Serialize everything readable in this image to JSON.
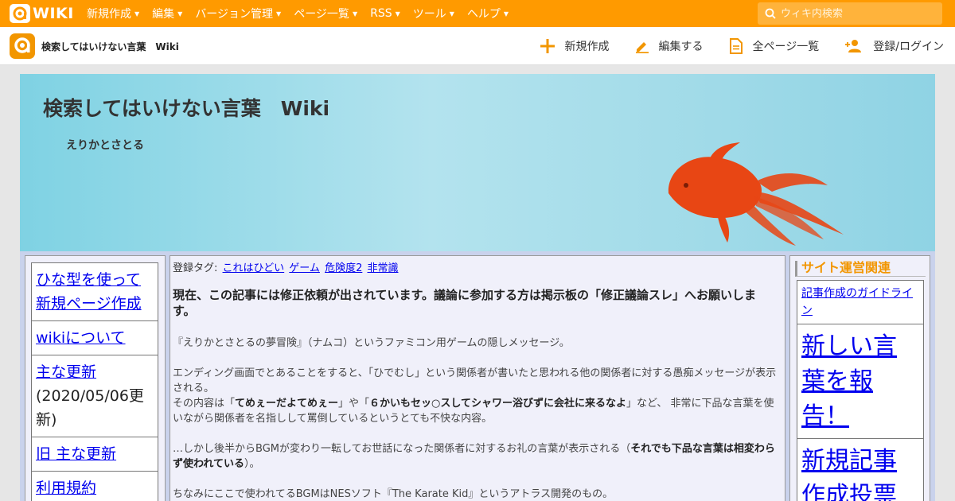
{
  "topbar": {
    "logo_text": "WIKI",
    "menu": [
      {
        "label": "新規作成"
      },
      {
        "label": "編集"
      },
      {
        "label": "バージョン管理"
      },
      {
        "label": "ページ一覧"
      },
      {
        "label": "RSS"
      },
      {
        "label": "ツール"
      },
      {
        "label": "ヘルプ"
      }
    ],
    "search_placeholder": "ウィキ内検索"
  },
  "subbar": {
    "site_name": "検索してはいけない言葉　Wiki",
    "actions": [
      {
        "label": "新規作成",
        "icon": "plus-icon"
      },
      {
        "label": "編集する",
        "icon": "pencil-icon"
      },
      {
        "label": "全ページ一覧",
        "icon": "document-icon"
      },
      {
        "label": "登録/ログイン",
        "icon": "users-icon"
      }
    ]
  },
  "banner": {
    "title": "検索してはいけない言葉　Wiki",
    "subtitle": "えりかとさとる"
  },
  "leftnav": {
    "items": [
      {
        "label": "ひな型を使って新規ページ作成"
      },
      {
        "label": "wikiについて"
      },
      {
        "label": "主な更新",
        "note": "(2020/05/06更新)"
      },
      {
        "label": "旧 主な更新"
      },
      {
        "label": "利用規約"
      }
    ]
  },
  "main": {
    "tags_label": "登録タグ:",
    "tags": [
      "これはひどい",
      "ゲーム",
      "危険度2",
      "非常識"
    ],
    "notice": "現在、この記事には修正依頼が出されています。議論に参加する方は掲示板の「修正議論スレ」へお願いします。",
    "p1": "『えりかとさとるの夢冒険』（ナムコ）というファミコン用ゲームの隠しメッセージ。",
    "p2a": "エンディング画面でとあることをすると、「ひでむし」という関係者が書いたと思われる他の関係者に対する愚痴メッセージが表示される。",
    "p2b_pre": "その内容は「",
    "p2b_q1": "てめぇーだよてめぇー",
    "p2b_mid": "」や「",
    "p2b_q2": "６かいもセッ○スしてシャワー浴びずに会社に来るなよ",
    "p2b_post": "」など、 非常に下品な言葉を使いながら関係者を名指しして罵倒しているというとても不快な内容。",
    "p3_pre": "…しかし後半からBGMが変わり一転してお世話になった関係者に対するお礼の言葉が表示される（",
    "p3_bold": "それでも下品な言葉は相変わらず使われている",
    "p3_post": "）。",
    "p4": "ちなみにここで使われてるBGMはNESソフト『The Karate Kid』というアトラス開発のもの。"
  },
  "rightnav": {
    "heading": "サイト運営関連",
    "items": [
      {
        "label": "記事作成のガイドライン"
      },
      {
        "label": "新しい言葉を報告！"
      },
      {
        "label": "新規記事作成投票"
      }
    ]
  },
  "colors": {
    "topbar": "#ff9a00",
    "accent": "#f29600",
    "fish": "#e84614",
    "link": "#0000ee"
  }
}
